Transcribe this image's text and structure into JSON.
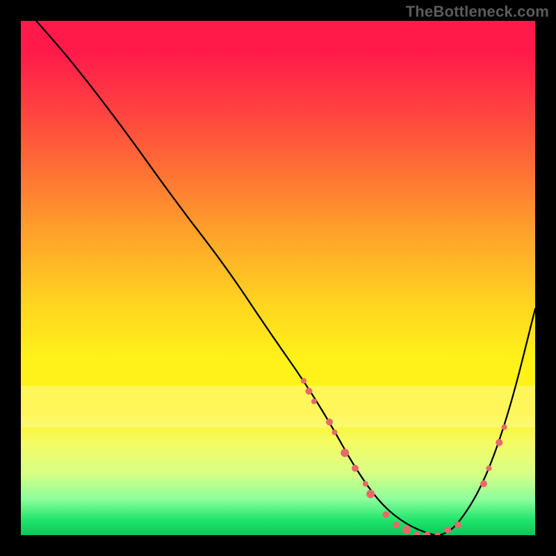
{
  "watermark": "TheBottleneck.com",
  "chart_data": {
    "type": "line",
    "title": "",
    "xlabel": "",
    "ylabel": "",
    "xlim": [
      0,
      100
    ],
    "ylim": [
      0,
      100
    ],
    "grid": false,
    "series": [
      {
        "name": "curve",
        "color": "#000000",
        "x": [
          3,
          10,
          20,
          30,
          40,
          48,
          55,
          60,
          65,
          70,
          75,
          80,
          82,
          85,
          90,
          95,
          100
        ],
        "y": [
          100,
          92,
          79,
          65,
          52,
          40,
          30,
          22,
          13,
          6,
          2,
          0,
          0,
          2,
          10,
          24,
          44
        ]
      }
    ],
    "markers": [
      {
        "name": "m1",
        "x": 55,
        "y": 30,
        "size": 4
      },
      {
        "name": "m2",
        "x": 56,
        "y": 28,
        "size": 5
      },
      {
        "name": "m3",
        "x": 57,
        "y": 26,
        "size": 4
      },
      {
        "name": "m4",
        "x": 60,
        "y": 22,
        "size": 5
      },
      {
        "name": "m5",
        "x": 61,
        "y": 20,
        "size": 4
      },
      {
        "name": "m6",
        "x": 63,
        "y": 16,
        "size": 6
      },
      {
        "name": "m7",
        "x": 65,
        "y": 13,
        "size": 5
      },
      {
        "name": "m8",
        "x": 67,
        "y": 10,
        "size": 4
      },
      {
        "name": "m9",
        "x": 68,
        "y": 8,
        "size": 6
      },
      {
        "name": "m10",
        "x": 71,
        "y": 4,
        "size": 5
      },
      {
        "name": "m11",
        "x": 73,
        "y": 2,
        "size": 5
      },
      {
        "name": "m12",
        "x": 75,
        "y": 1,
        "size": 6
      },
      {
        "name": "m13",
        "x": 77,
        "y": 0,
        "size": 5
      },
      {
        "name": "m14",
        "x": 79,
        "y": 0,
        "size": 5
      },
      {
        "name": "m15",
        "x": 81,
        "y": 0,
        "size": 4
      },
      {
        "name": "m16",
        "x": 83,
        "y": 1,
        "size": 5
      },
      {
        "name": "m17",
        "x": 85,
        "y": 2,
        "size": 5
      },
      {
        "name": "m18",
        "x": 90,
        "y": 10,
        "size": 5
      },
      {
        "name": "m19",
        "x": 91,
        "y": 13,
        "size": 4
      },
      {
        "name": "m20",
        "x": 93,
        "y": 18,
        "size": 5
      },
      {
        "name": "m21",
        "x": 94,
        "y": 21,
        "size": 4
      }
    ],
    "marker_color": "#e66a6a",
    "background": {
      "type": "vertical-gradient",
      "stops": [
        {
          "pos": 0.0,
          "color": "#ff1a4a"
        },
        {
          "pos": 0.3,
          "color": "#ff7433"
        },
        {
          "pos": 0.56,
          "color": "#ffd81f"
        },
        {
          "pos": 0.76,
          "color": "#fff21a"
        },
        {
          "pos": 0.93,
          "color": "#8cff9c"
        },
        {
          "pos": 1.0,
          "color": "#09c85a"
        }
      ]
    }
  }
}
